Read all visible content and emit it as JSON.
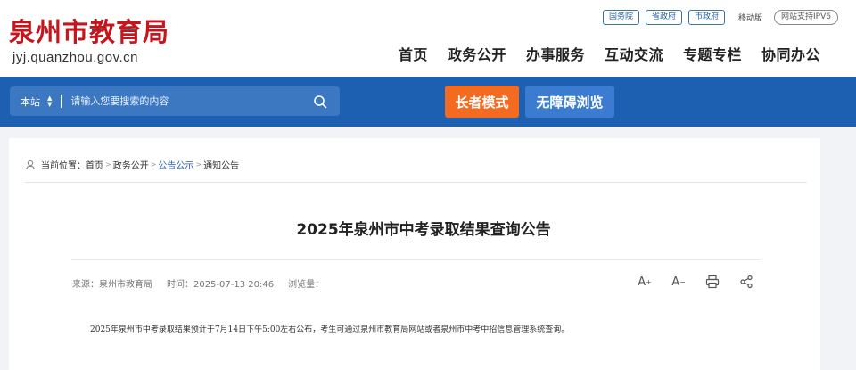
{
  "header": {
    "logo_title": "泉州市教育局",
    "logo_domain": "jyj.quanzhou.gov.cn",
    "top_links": [
      "国务院",
      "省政府",
      "市政府"
    ],
    "mobile": "移动版",
    "ipv6": "网站支持IPV6",
    "nav": [
      "首页",
      "政务公开",
      "办事服务",
      "互动交流",
      "专题专栏",
      "协同办公"
    ]
  },
  "searchbar": {
    "scope": "本站",
    "placeholder": "请输入您要搜索的内容",
    "elder_mode": "长者模式",
    "accessible": "无障碍浏览"
  },
  "breadcrumb": {
    "label": "当前位置：",
    "items": [
      "首页",
      "政务公开",
      "公告公示",
      "通知公告"
    ]
  },
  "article": {
    "title": "2025年泉州市中考录取结果查询公告",
    "source": "来源：泉州市教育局",
    "time": "时间：2025-07-13 20:46",
    "views": "浏览量：",
    "body": "2025年泉州市中考录取结果预计于7月14日下午5:00左右公布，考生可通过泉州市教育局网站或者泉州市中考中招信息管理系统查询。"
  },
  "tools": {
    "font_up": "A",
    "font_down": "A"
  },
  "colors": {
    "brand_red": "#c4161c",
    "bar_blue": "#1d5fb0",
    "elder_orange": "#f26b21",
    "accessible_blue": "#3c7cd0"
  }
}
